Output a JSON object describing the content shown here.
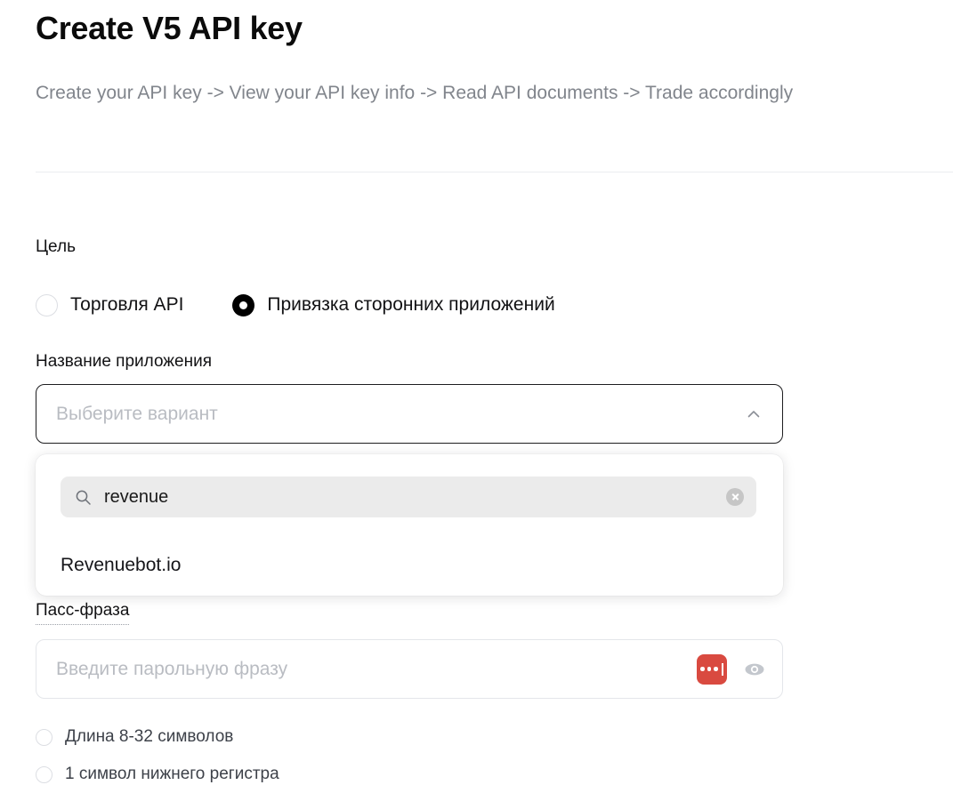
{
  "header": {
    "title": "Create V5 API key",
    "subtitle": "Create your API key -> View your API key info -> Read API documents -> Trade accordingly"
  },
  "purpose": {
    "label": "Цель",
    "options": [
      {
        "label": "Торговля API",
        "selected": false
      },
      {
        "label": "Привязка сторонних приложений",
        "selected": true
      }
    ]
  },
  "app_name": {
    "label": "Название приложения",
    "select": {
      "placeholder": "Выберите вариант",
      "value": "",
      "expanded": true,
      "chevron": "chevron-up-icon"
    },
    "dropdown": {
      "search": {
        "icon": "search-icon",
        "value": "revenue",
        "placeholder": "",
        "clear_icon": "clear-circle-icon"
      },
      "options": [
        {
          "label": "Revenuebot.io"
        }
      ]
    }
  },
  "passphrase": {
    "label": "Пасс-фраза",
    "placeholder": "Введите парольную фразу",
    "value": "",
    "password_manager_icon": "password-manager-icon",
    "reveal_icon": "eye-icon"
  },
  "rules": [
    {
      "label": "Длина 8-32 символов",
      "met": false
    },
    {
      "label": "1 символ нижнего регистра",
      "met": false
    }
  ],
  "colors": {
    "accent_red": "#d94a40",
    "text_primary": "#121214",
    "text_muted": "#81858c",
    "placeholder": "#b9bcc2",
    "border_focus": "#1d1d1f",
    "border_idle": "#e4e6ea",
    "search_bg": "#ebebeb"
  }
}
